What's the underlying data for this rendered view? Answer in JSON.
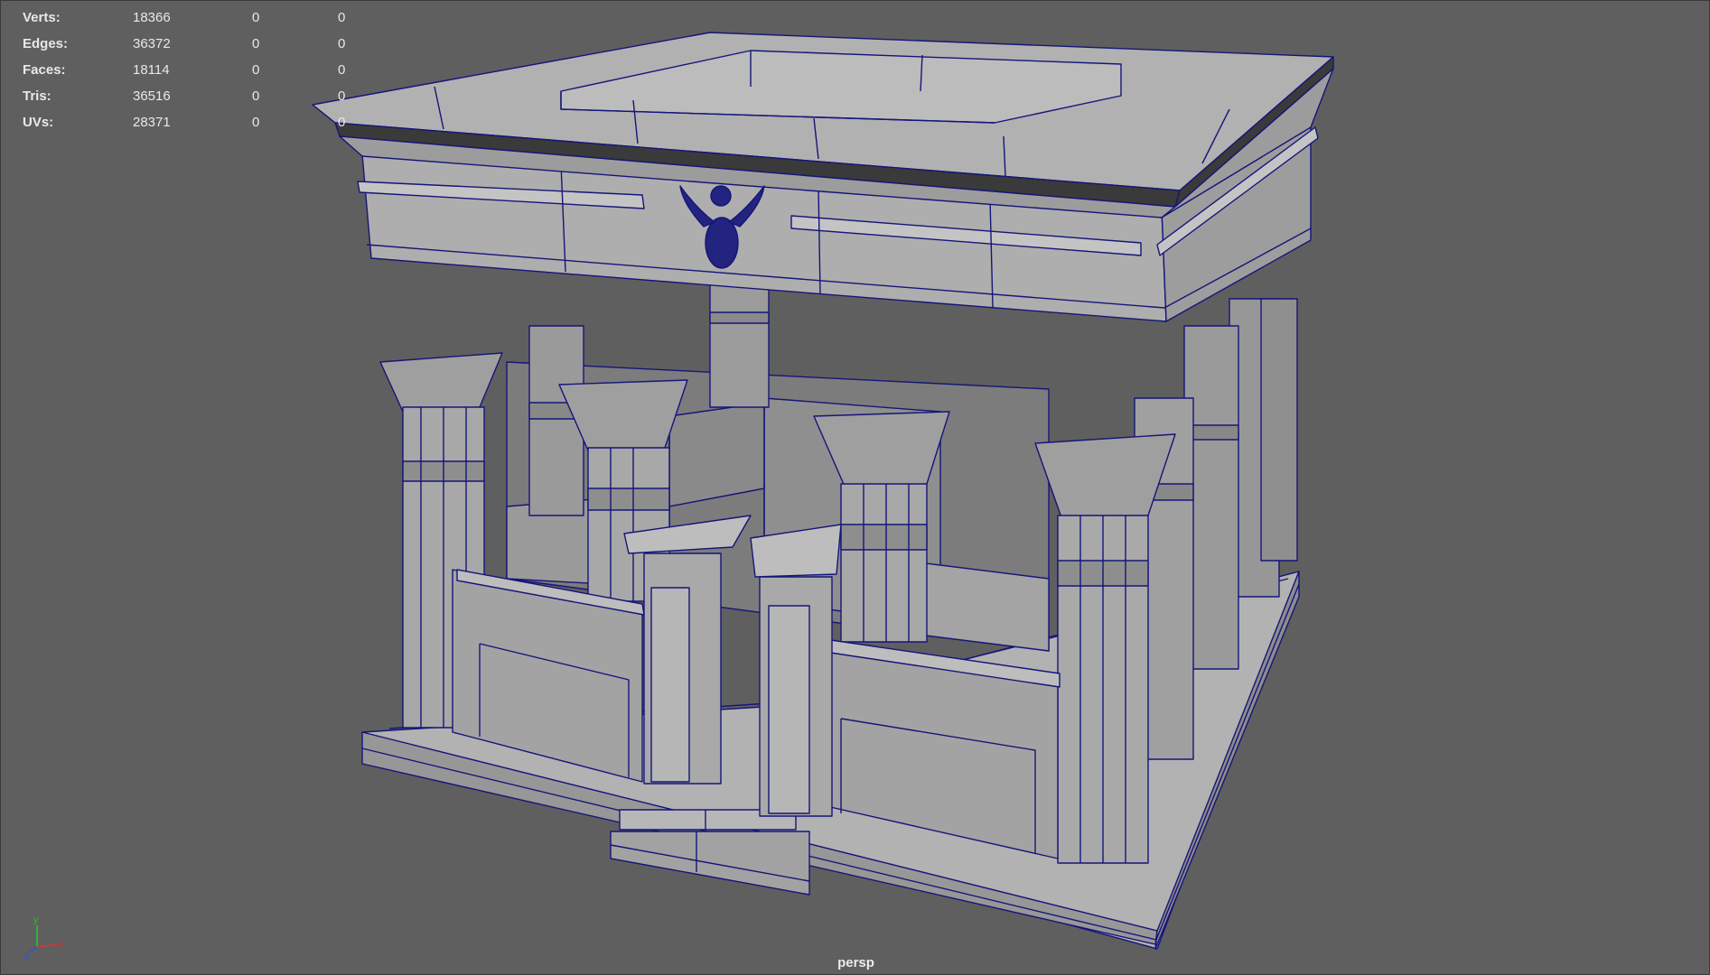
{
  "hud": {
    "rows": [
      {
        "label": "Verts:",
        "value": "18366",
        "selected": "0",
        "triangle": "0"
      },
      {
        "label": "Edges:",
        "value": "36372",
        "selected": "0",
        "triangle": "0"
      },
      {
        "label": "Faces:",
        "value": "18114",
        "selected": "0",
        "triangle": "0"
      },
      {
        "label": "Tris:",
        "value": "36516",
        "selected": "0",
        "triangle": "0"
      },
      {
        "label": "UVs:",
        "value": "28371",
        "selected": "0",
        "triangle": "0"
      }
    ]
  },
  "viewport": {
    "camera_label": "persp",
    "background_color": "#5f5f5f",
    "wire_color": "#15157a",
    "surface_color": "#a9a9a9"
  },
  "axis_gizmo": {
    "x_label": "x",
    "y_label": "y",
    "z_label": "z",
    "x_color": "#e03030",
    "y_color": "#30c030",
    "z_color": "#3050e0"
  }
}
